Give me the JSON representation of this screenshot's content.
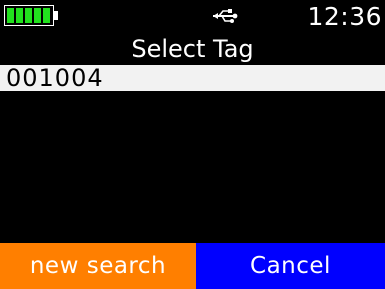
{
  "status_bar": {
    "battery_level": 1.0,
    "battery_color": "#22e01e",
    "connection_icon": "usb-icon",
    "time": "12:36"
  },
  "header": {
    "title": "Select Tag"
  },
  "tag_list": {
    "items": [
      {
        "label": "001004",
        "selected": true
      }
    ]
  },
  "softkeys": {
    "left_label": "new search",
    "left_color": "#ff7f00",
    "right_label": "Cancel",
    "right_color": "#0000ff"
  }
}
